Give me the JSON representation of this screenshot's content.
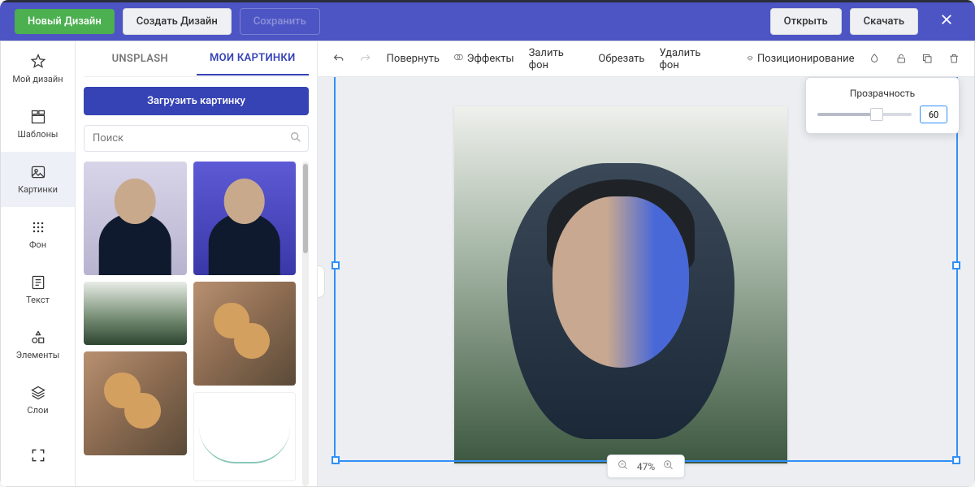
{
  "topbar": {
    "new_design": "Новый Дизайн",
    "create_design": "Создать Дизайн",
    "save": "Сохранить",
    "open": "Открыть",
    "download": "Скачать"
  },
  "leftnav": {
    "my_design": "Мой дизайн",
    "templates": "Шаблоны",
    "images": "Картинки",
    "background": "Фон",
    "text": "Текст",
    "elements": "Элементы",
    "layers": "Слои"
  },
  "tabs": {
    "unsplash": "UNSPLASH",
    "my_images": "МОИ КАРТИНКИ"
  },
  "sidepanel": {
    "upload": "Загрузить картинку",
    "search_placeholder": "Поиск"
  },
  "toolbar": {
    "rotate": "Повернуть",
    "effects": "Эффекты",
    "fill_bg": "Залить фон",
    "crop": "Обрезать",
    "remove_bg": "Удалить фон",
    "positioning": "Позиционирование"
  },
  "popover": {
    "title": "Прозрачность",
    "value": "60"
  },
  "zoom": {
    "value": "47%"
  }
}
